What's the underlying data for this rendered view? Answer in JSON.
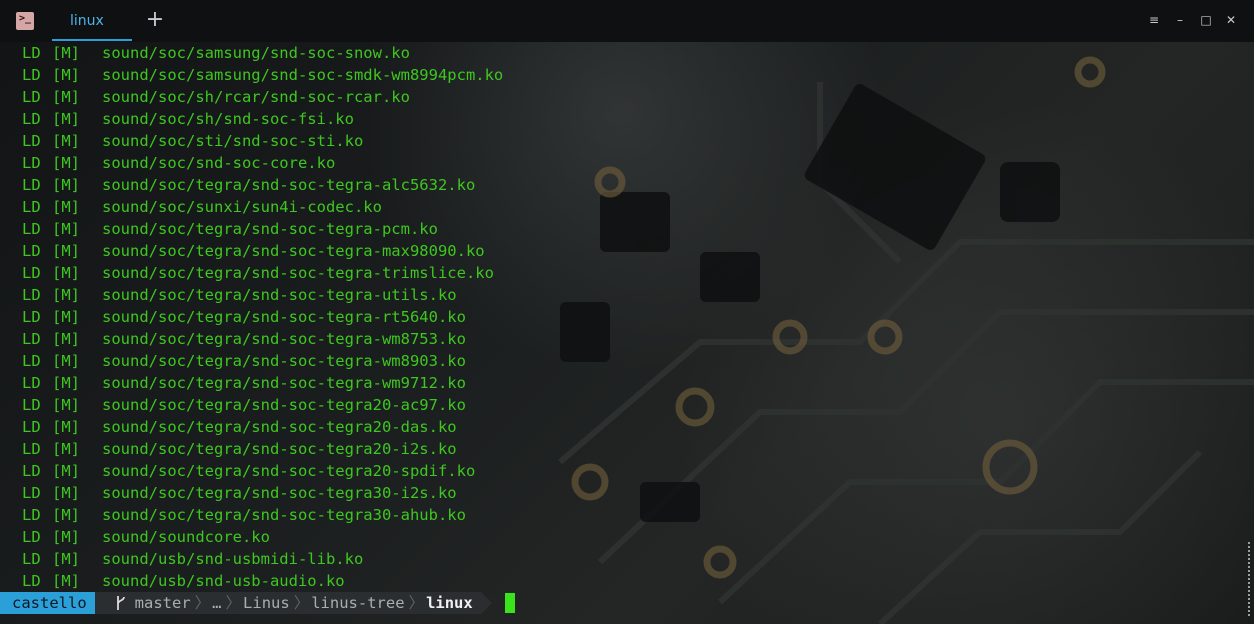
{
  "window": {
    "tab_label": "linux",
    "new_tab_symbol": "+",
    "icon_glyph": ">_",
    "menu_symbol": "≡",
    "minimize_symbol": "–",
    "maximize_symbol": "□",
    "close_symbol": "✕"
  },
  "terminal": {
    "text_color": "#3ec71f",
    "lines": [
      {
        "tag": "LD",
        "flag": "[M]",
        "path": "sound/soc/samsung/snd-soc-snow.ko"
      },
      {
        "tag": "LD",
        "flag": "[M]",
        "path": "sound/soc/samsung/snd-soc-smdk-wm8994pcm.ko"
      },
      {
        "tag": "LD",
        "flag": "[M]",
        "path": "sound/soc/sh/rcar/snd-soc-rcar.ko"
      },
      {
        "tag": "LD",
        "flag": "[M]",
        "path": "sound/soc/sh/snd-soc-fsi.ko"
      },
      {
        "tag": "LD",
        "flag": "[M]",
        "path": "sound/soc/sti/snd-soc-sti.ko"
      },
      {
        "tag": "LD",
        "flag": "[M]",
        "path": "sound/soc/snd-soc-core.ko"
      },
      {
        "tag": "LD",
        "flag": "[M]",
        "path": "sound/soc/tegra/snd-soc-tegra-alc5632.ko"
      },
      {
        "tag": "LD",
        "flag": "[M]",
        "path": "sound/soc/sunxi/sun4i-codec.ko"
      },
      {
        "tag": "LD",
        "flag": "[M]",
        "path": "sound/soc/tegra/snd-soc-tegra-pcm.ko"
      },
      {
        "tag": "LD",
        "flag": "[M]",
        "path": "sound/soc/tegra/snd-soc-tegra-max98090.ko"
      },
      {
        "tag": "LD",
        "flag": "[M]",
        "path": "sound/soc/tegra/snd-soc-tegra-trimslice.ko"
      },
      {
        "tag": "LD",
        "flag": "[M]",
        "path": "sound/soc/tegra/snd-soc-tegra-utils.ko"
      },
      {
        "tag": "LD",
        "flag": "[M]",
        "path": "sound/soc/tegra/snd-soc-tegra-rt5640.ko"
      },
      {
        "tag": "LD",
        "flag": "[M]",
        "path": "sound/soc/tegra/snd-soc-tegra-wm8753.ko"
      },
      {
        "tag": "LD",
        "flag": "[M]",
        "path": "sound/soc/tegra/snd-soc-tegra-wm8903.ko"
      },
      {
        "tag": "LD",
        "flag": "[M]",
        "path": "sound/soc/tegra/snd-soc-tegra-wm9712.ko"
      },
      {
        "tag": "LD",
        "flag": "[M]",
        "path": "sound/soc/tegra/snd-soc-tegra20-ac97.ko"
      },
      {
        "tag": "LD",
        "flag": "[M]",
        "path": "sound/soc/tegra/snd-soc-tegra20-das.ko"
      },
      {
        "tag": "LD",
        "flag": "[M]",
        "path": "sound/soc/tegra/snd-soc-tegra20-i2s.ko"
      },
      {
        "tag": "LD",
        "flag": "[M]",
        "path": "sound/soc/tegra/snd-soc-tegra20-spdif.ko"
      },
      {
        "tag": "LD",
        "flag": "[M]",
        "path": "sound/soc/tegra/snd-soc-tegra30-i2s.ko"
      },
      {
        "tag": "LD",
        "flag": "[M]",
        "path": "sound/soc/tegra/snd-soc-tegra30-ahub.ko"
      },
      {
        "tag": "LD",
        "flag": "[M]",
        "path": "sound/soundcore.ko"
      },
      {
        "tag": "LD",
        "flag": "[M]",
        "path": "sound/usb/snd-usbmidi-lib.ko"
      },
      {
        "tag": "LD",
        "flag": "[M]",
        "path": "sound/usb/snd-usb-audio.ko"
      }
    ]
  },
  "prompt": {
    "user": "castello",
    "branch_icon": "branch-icon",
    "branch": "master",
    "ellipsis": "…",
    "path_parts": [
      "Linus",
      "linus-tree"
    ],
    "current_dir": "linux",
    "separator": "〉",
    "colors": {
      "user_bg": "#2a9fd8",
      "segment_bg": "#2b2e30",
      "cursor": "#39e51a"
    }
  }
}
